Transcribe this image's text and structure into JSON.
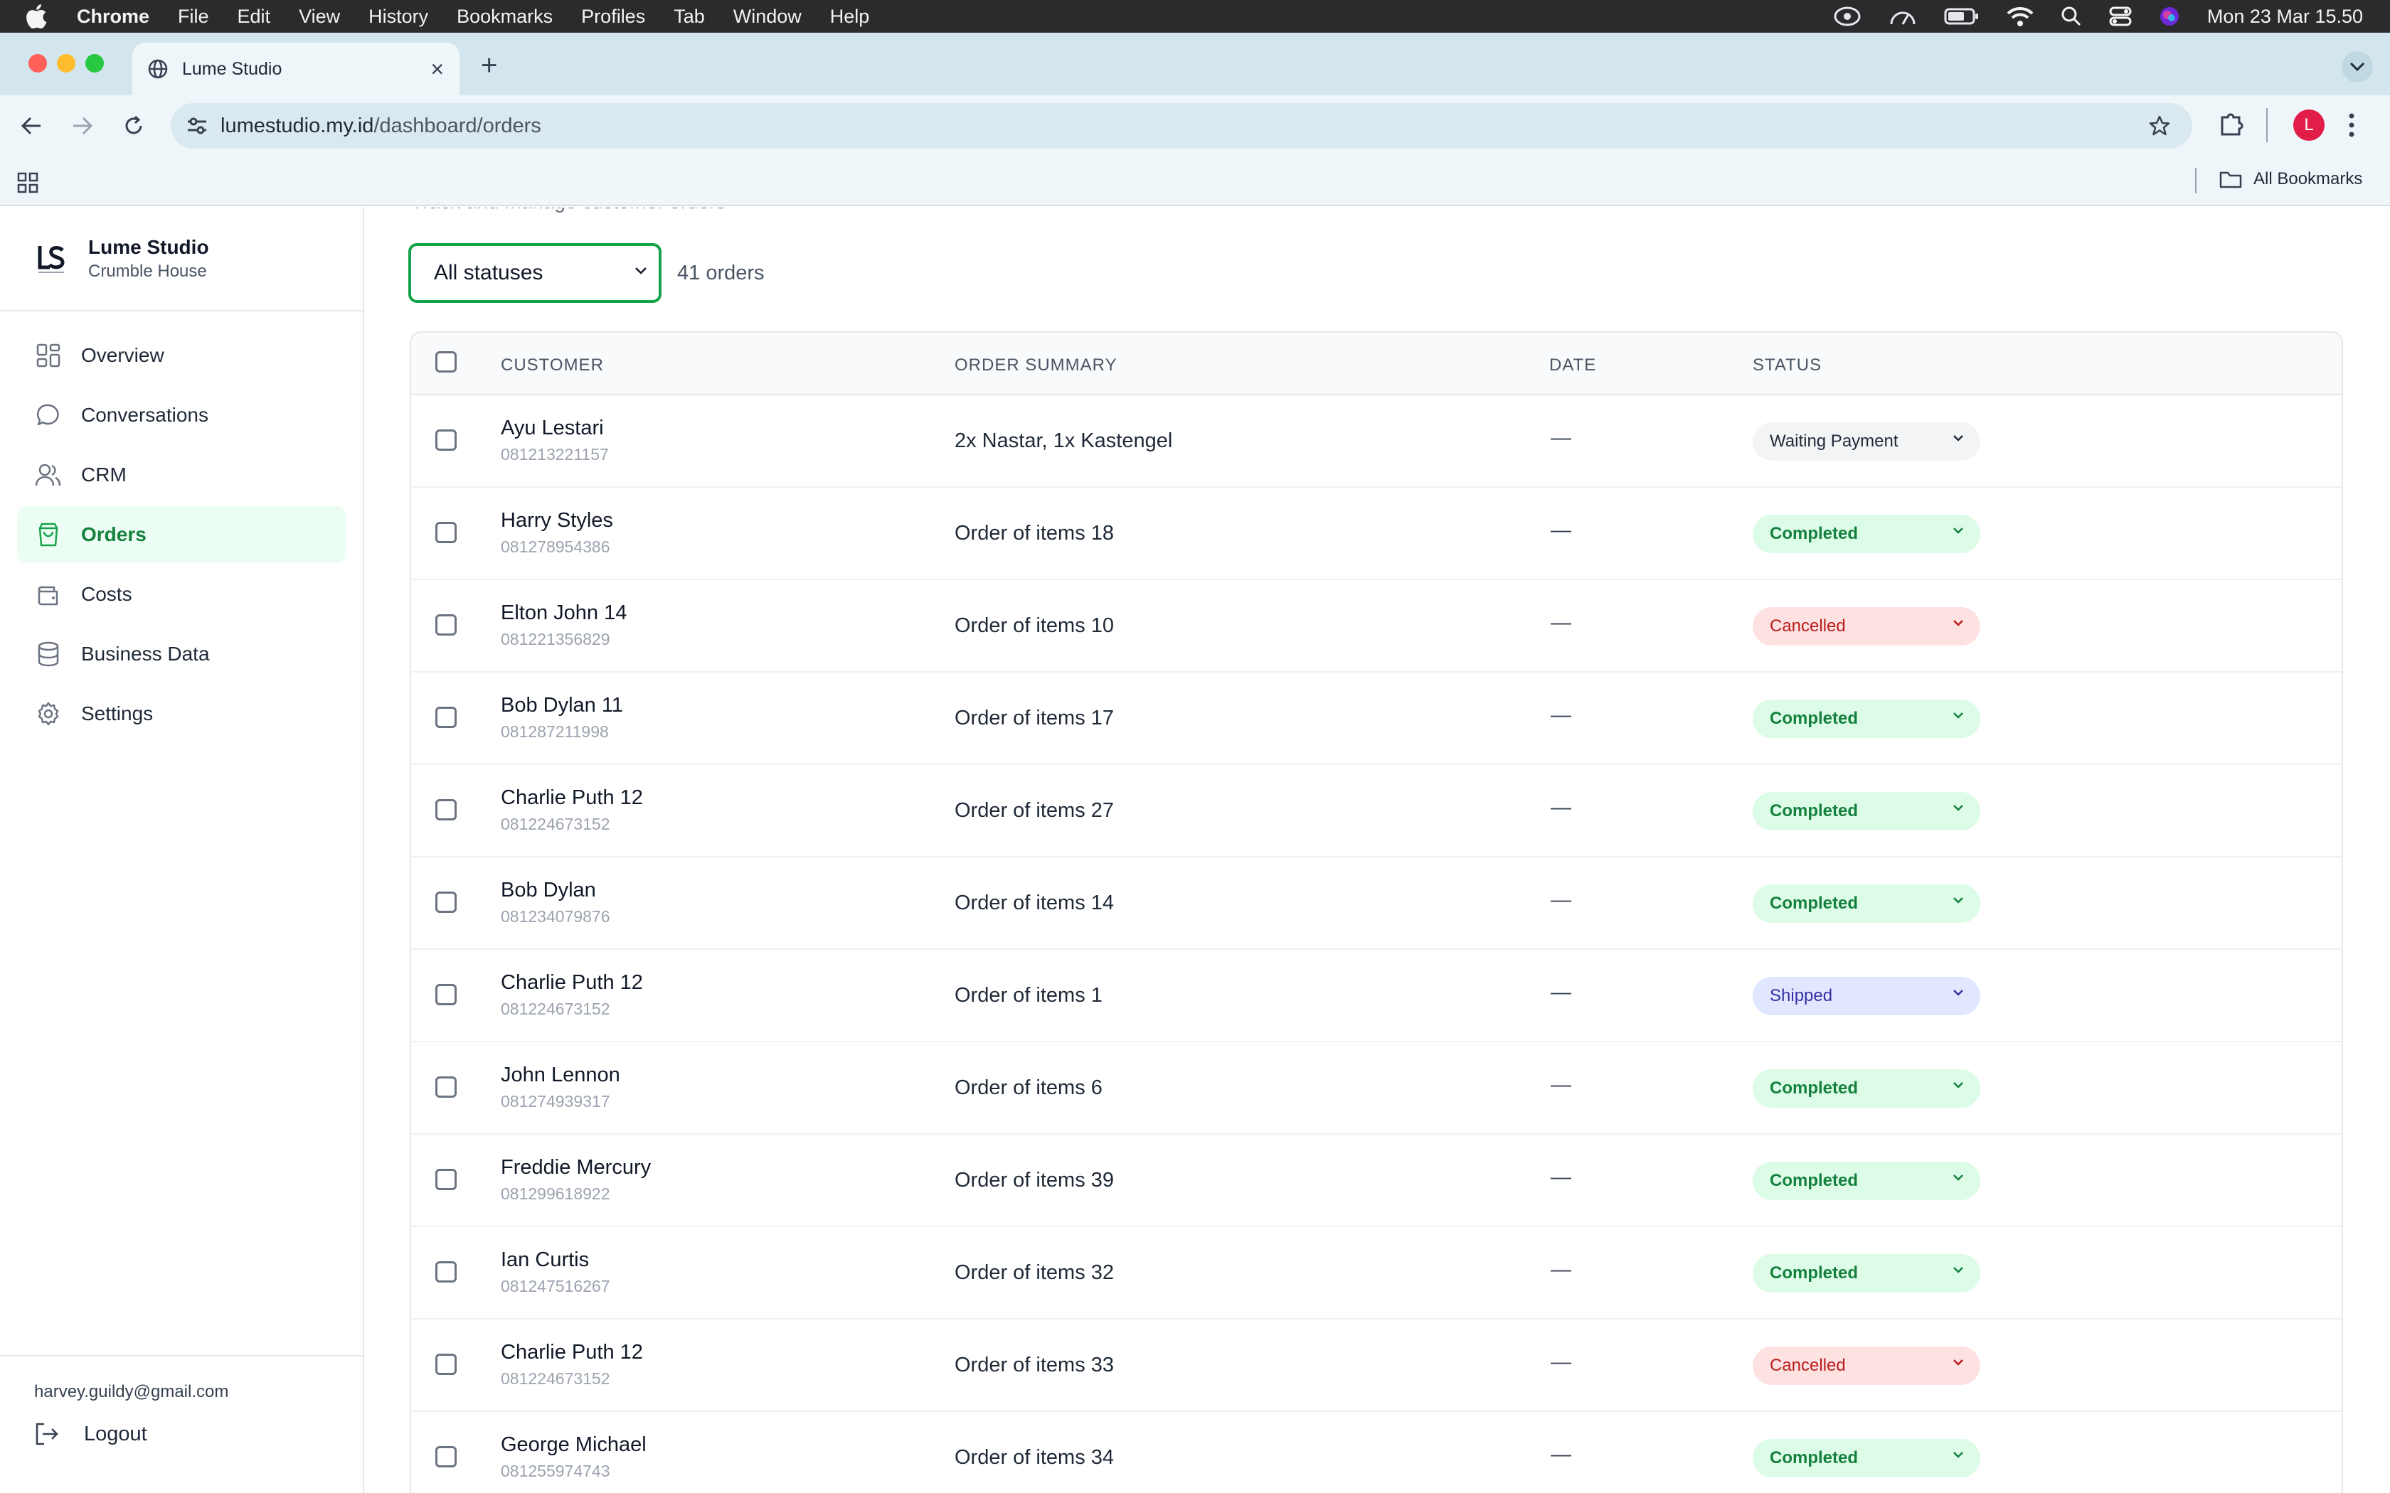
{
  "menubar": {
    "app": "Chrome",
    "items": [
      "File",
      "Edit",
      "View",
      "History",
      "Bookmarks",
      "Profiles",
      "Tab",
      "Window",
      "Help"
    ],
    "clock": "Mon 23 Mar  15.50"
  },
  "browser": {
    "tab_title": "Lume Studio",
    "url_host": "lumestudio.my.id",
    "url_path": "/dashboard/orders",
    "profile_initial": "L",
    "all_bookmarks": "All Bookmarks"
  },
  "sidebar": {
    "brand_name": "Lume Studio",
    "brand_sub": "Crumble House",
    "items": [
      {
        "label": "Overview",
        "icon": "grid-icon"
      },
      {
        "label": "Conversations",
        "icon": "chat-icon"
      },
      {
        "label": "CRM",
        "icon": "users-icon"
      },
      {
        "label": "Orders",
        "icon": "bag-icon",
        "active": true
      },
      {
        "label": "Costs",
        "icon": "wallet-icon"
      },
      {
        "label": "Business Data",
        "icon": "database-icon"
      },
      {
        "label": "Settings",
        "icon": "gear-icon"
      }
    ],
    "email": "harvey.guildy@gmail.com",
    "logout": "Logout"
  },
  "main": {
    "subtitle": "Track and manage customer orders",
    "filter_value": "All statuses",
    "order_count": "41 orders",
    "columns": {
      "customer": "CUSTOMER",
      "summary": "ORDER SUMMARY",
      "date": "DATE",
      "status": "STATUS"
    },
    "rows": [
      {
        "name": "Ayu Lestari",
        "phone": "081213221157",
        "summary": "2x Nastar, 1x Kastengel",
        "date": "—",
        "status": "Waiting Payment"
      },
      {
        "name": "Harry Styles",
        "phone": "081278954386",
        "summary": "Order of items 18",
        "date": "—",
        "status": "Completed"
      },
      {
        "name": "Elton John 14",
        "phone": "081221356829",
        "summary": "Order of items 10",
        "date": "—",
        "status": "Cancelled"
      },
      {
        "name": "Bob Dylan 11",
        "phone": "081287211998",
        "summary": "Order of items 17",
        "date": "—",
        "status": "Completed"
      },
      {
        "name": "Charlie Puth 12",
        "phone": "081224673152",
        "summary": "Order of items 27",
        "date": "—",
        "status": "Completed"
      },
      {
        "name": "Bob Dylan",
        "phone": "081234079876",
        "summary": "Order of items 14",
        "date": "—",
        "status": "Completed"
      },
      {
        "name": "Charlie Puth 12",
        "phone": "081224673152",
        "summary": "Order of items 1",
        "date": "—",
        "status": "Shipped"
      },
      {
        "name": "John Lennon",
        "phone": "081274939317",
        "summary": "Order of items 6",
        "date": "—",
        "status": "Completed"
      },
      {
        "name": "Freddie Mercury",
        "phone": "081299618922",
        "summary": "Order of items 39",
        "date": "—",
        "status": "Completed"
      },
      {
        "name": "Ian Curtis",
        "phone": "081247516267",
        "summary": "Order of items 32",
        "date": "—",
        "status": "Completed"
      },
      {
        "name": "Charlie Puth 12",
        "phone": "081224673152",
        "summary": "Order of items 33",
        "date": "—",
        "status": "Cancelled"
      },
      {
        "name": "George Michael",
        "phone": "081255974743",
        "summary": "Order of items 34",
        "date": "—",
        "status": "Completed"
      }
    ]
  },
  "colors": {
    "accent_green": "#16a34a",
    "completed_bg": "#dcfce7",
    "cancelled_bg": "#fee2e2",
    "shipped_bg": "#e0e7ff",
    "waiting_bg": "#f3f4f6"
  }
}
